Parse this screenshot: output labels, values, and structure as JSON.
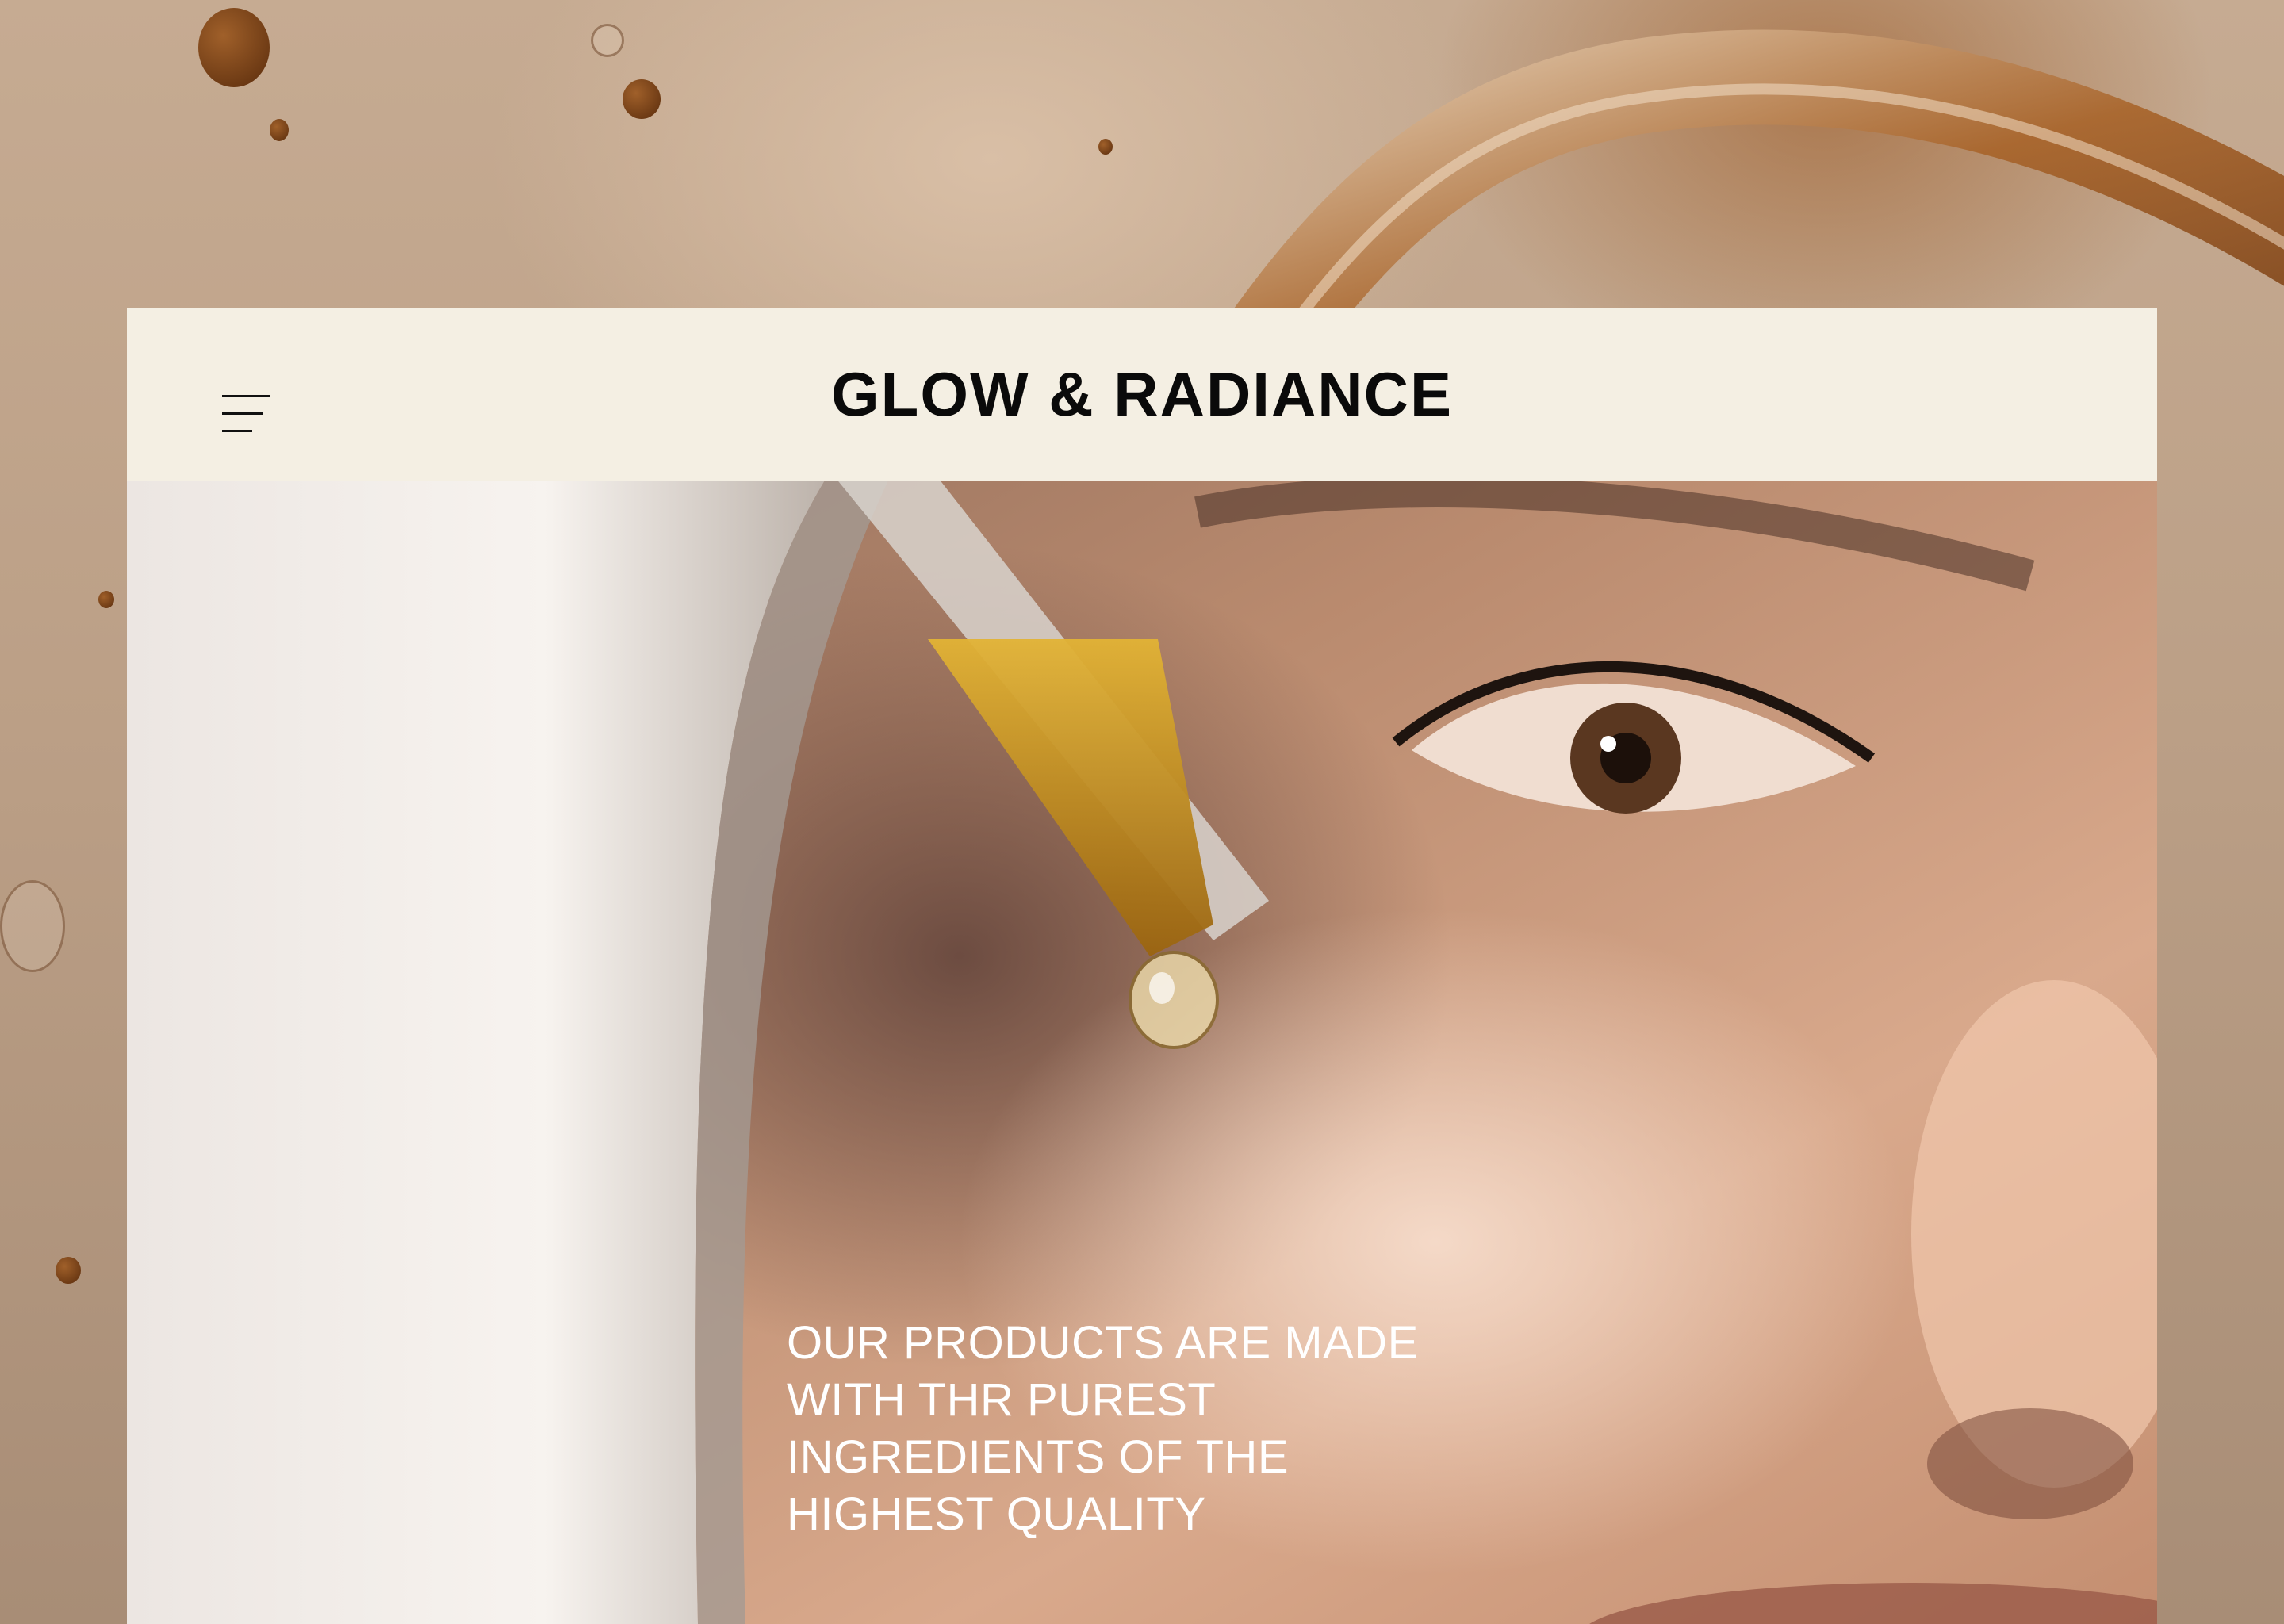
{
  "header": {
    "brand": "GLOW & RADIANCE",
    "menu_icon": "hamburger-menu-icon"
  },
  "hero": {
    "tagline_lines": [
      "OUR PRODUCTS ARE MADE",
      "WITH THR PUREST",
      "INGREDIENTS OF THE",
      "HIGHEST QUALITY"
    ]
  },
  "colors": {
    "header_background": "#f4efe3",
    "brand_text": "#0a0a0a",
    "tagline_text": "#ffffff",
    "page_background": "#bfa38a"
  }
}
